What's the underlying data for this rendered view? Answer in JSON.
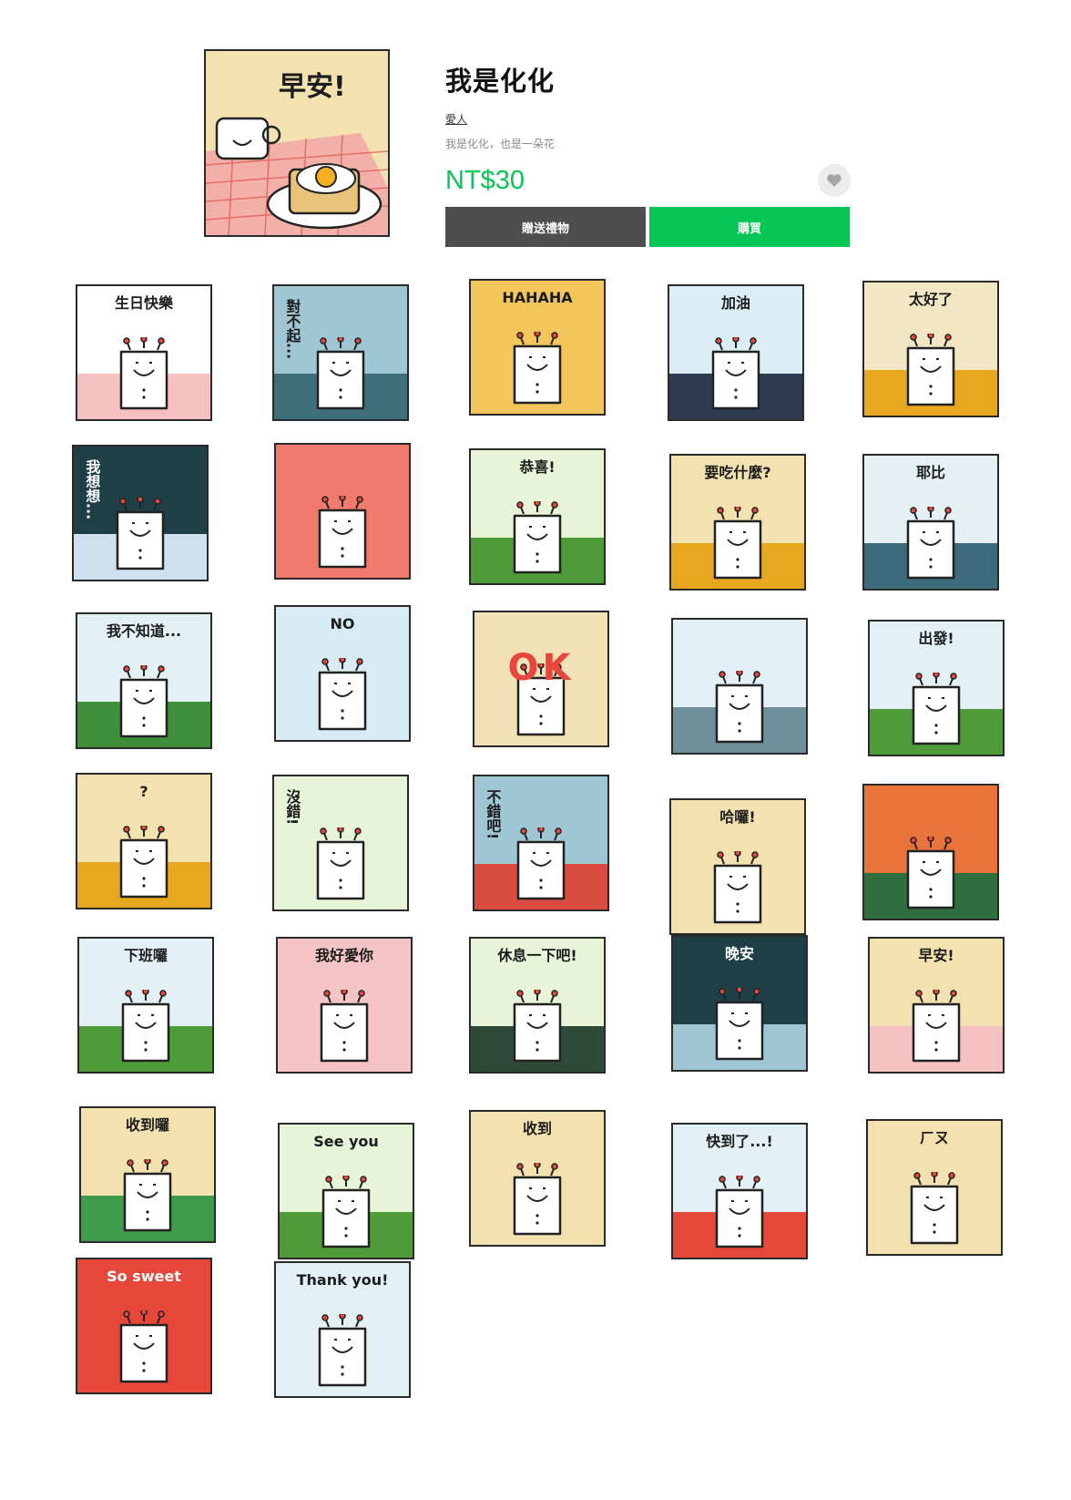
{
  "product": {
    "title": "我是化化",
    "author": "愛人",
    "description": "我是化化，也是一朵花",
    "price": "NT$30",
    "hero_label": "早安!",
    "gift_button": "贈送禮物",
    "buy_button": "購買",
    "favorite_icon": "heart-icon"
  },
  "colors": {
    "accent": "#06c755",
    "gift": "#4e4e4e"
  },
  "stickers": [
    {
      "label": "生日快樂",
      "bg": "#ffffff",
      "band": "#f4c0c0"
    },
    {
      "label": "對不起...",
      "bg": "#9fc6d3",
      "band": "#3f6f7a",
      "vertical": true
    },
    {
      "label": "HAHAHA",
      "bg": "#f3c65c",
      "band": "#f3c65c"
    },
    {
      "label": "加油",
      "bg": "#dbeef6",
      "band": "#2d3a4f"
    },
    {
      "label": "太好了",
      "bg": "#f2e6c4",
      "band": "#e7a81f"
    },
    {
      "label": "我想想...",
      "bg": "#1f3f47",
      "band": "#cfe0ee",
      "vertical": true,
      "light": true
    },
    {
      "label": "",
      "bg": "#f07a6c",
      "band": "#f07a6c"
    },
    {
      "label": "恭喜!",
      "bg": "#e7f4d8",
      "band": "#4f9b3a"
    },
    {
      "label": "要吃什麼?",
      "bg": "#f3e2b0",
      "band": "#e7a81f"
    },
    {
      "label": "耶比",
      "bg": "#e5f0f5",
      "band": "#3c6c7c"
    },
    {
      "label": "我不知道...",
      "bg": "#e3f1f7",
      "band": "#3f8f3a"
    },
    {
      "label": "NO",
      "bg": "#d7ecf5",
      "band": "#d7ecf5"
    },
    {
      "label": "OK",
      "bg": "#f2e1b5",
      "band": "#f2e1b5",
      "big": true
    },
    {
      "label": "",
      "bg": "#e3f1f7",
      "band": "#6f8f9c"
    },
    {
      "label": "出發!",
      "bg": "#e3f1f7",
      "band": "#4f9b3a"
    },
    {
      "label": "?",
      "bg": "#f3e2b0",
      "band": "#e7a81f"
    },
    {
      "label": "沒錯!",
      "bg": "#e7f4d8",
      "band": "#e7f4d8",
      "vertical": true
    },
    {
      "label": "不錯吧!",
      "bg": "#9fc6d3",
      "band": "#d94b3f",
      "vertical": true
    },
    {
      "label": "哈囉!",
      "bg": "#f3e2b0",
      "band": "#f3e2b0"
    },
    {
      "label": "",
      "bg": "#e8743c",
      "band": "#2f6f3e"
    },
    {
      "label": "下班囉",
      "bg": "#e3f1f7",
      "band": "#4f9b3a"
    },
    {
      "label": "我好愛你",
      "bg": "#f6c4c4",
      "band": "#f6c4c4"
    },
    {
      "label": "休息一下吧!",
      "bg": "#e7f4d8",
      "band": "#2e4a3a"
    },
    {
      "label": "晚安",
      "bg": "#1f3f47",
      "band": "#9fc6d3",
      "light": true
    },
    {
      "label": "早安!",
      "bg": "#f3e2b0",
      "band": "#f4c0c0"
    },
    {
      "label": "收到囉",
      "bg": "#f3e2b0",
      "band": "#3f9b4a"
    },
    {
      "label": "See you",
      "bg": "#e7f4d8",
      "band": "#4f9b3a"
    },
    {
      "label": "收到",
      "bg": "#f3e2b0",
      "band": "#f3e2b0"
    },
    {
      "label": "快到了...!",
      "bg": "#e3f1f7",
      "band": "#e5483b"
    },
    {
      "label": "ㄏㄡ",
      "bg": "#f3e2b0",
      "band": "#f3e2b0"
    },
    {
      "label": "So sweet",
      "bg": "#e5483b",
      "band": "#e5483b",
      "light": true
    },
    {
      "label": "Thank you!",
      "bg": "#e3f1f7",
      "band": "#e3f1f7"
    }
  ]
}
